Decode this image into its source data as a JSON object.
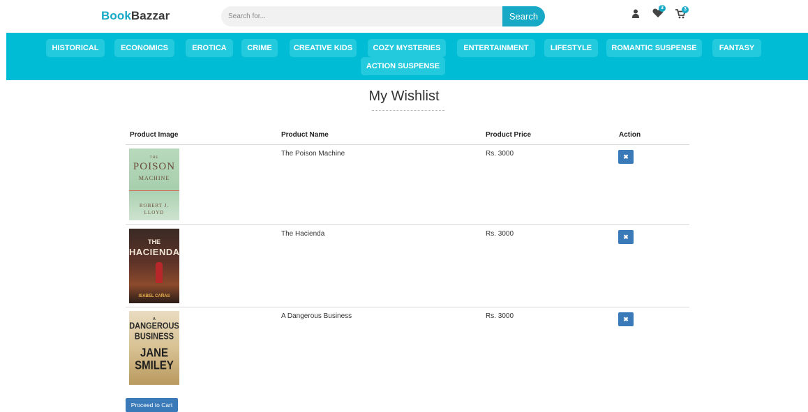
{
  "header": {
    "logo_part1": "Book",
    "logo_part2": "Bazzar",
    "search_placeholder": "Search for...",
    "search_button": "Search",
    "wishlist_count": "3",
    "cart_count": "3"
  },
  "categories": [
    "HISTORICAL",
    "ECONOMICS",
    "EROTICA",
    "CRIME",
    "CREATIVE KIDS",
    "COZY MYSTERIES",
    "ENTERTAINMENT",
    "LIFESTYLE",
    "ROMANTIC SUSPENSE",
    "FANTASY",
    "ACTION SUSPENSE"
  ],
  "page_title": "My Wishlist",
  "table": {
    "headers": {
      "image": "Product Image",
      "name": "Product Name",
      "price": "Product Price",
      "action": "Action"
    },
    "rows": [
      {
        "name": "The Poison Machine",
        "price": "Rs. 3000",
        "cover": {
          "line1": "THE",
          "line2": "POISON",
          "line3": "MACHINE",
          "line4": "ROBERT J.",
          "line5": "LLOYD"
        }
      },
      {
        "name": "The Hacienda",
        "price": "Rs. 3000",
        "cover": {
          "line1": "THE",
          "line2": "HACIENDA",
          "line3": "ISABEL CAÑAS"
        }
      },
      {
        "name": "A Dangerous Business",
        "price": "Rs. 3000",
        "cover": {
          "line1": "A",
          "line2": "DANGEROUS",
          "line3": "BUSINESS",
          "line4": "JANE",
          "line5": "SMILEY"
        }
      }
    ],
    "remove_symbol": "✖"
  },
  "proceed_button": "Proceed to Cart",
  "colors": {
    "accent": "#17a9c6",
    "category_bar": "#00bcd4",
    "button": "#3a7ab8"
  },
  "icons": {
    "user": "user-icon",
    "wishlist": "heart-icon",
    "cart": "cart-icon",
    "remove": "close-icon"
  }
}
